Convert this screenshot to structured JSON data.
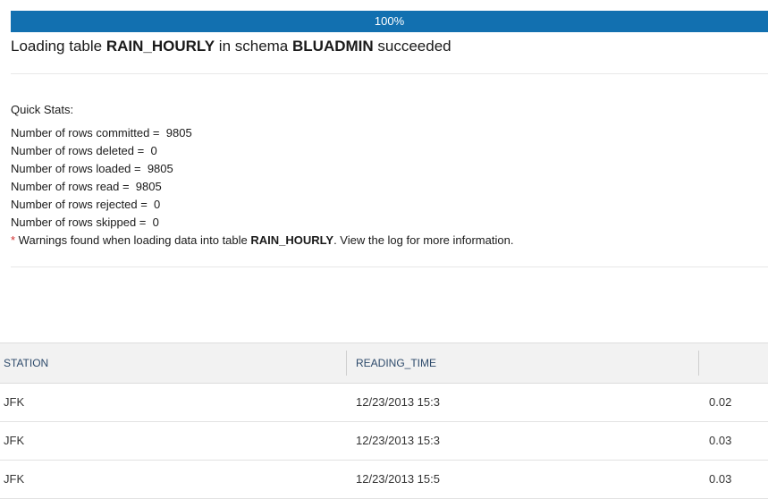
{
  "progress": {
    "value": 100,
    "label": "100%",
    "color": "#1270b0"
  },
  "title": {
    "prefix": "Loading table ",
    "table": "RAIN_HOURLY",
    "middle": " in schema ",
    "schema": "BLUADMIN",
    "suffix": " succeeded"
  },
  "quick_stats": {
    "heading": "Quick Stats:",
    "rows": [
      "Number of rows committed =  9805",
      "Number of rows deleted =  0",
      "Number of rows loaded =  9805",
      "Number of rows read =  9805",
      "Number of rows rejected =  0",
      "Number of rows skipped =  0"
    ],
    "warning": {
      "star": "*",
      "prefix": " Warnings found when loading data into table ",
      "table": "RAIN_HOURLY",
      "suffix": ". View the log for more information."
    }
  },
  "grid": {
    "columns": [
      "STATION",
      "READING_TIME",
      ""
    ],
    "rows": [
      [
        "JFK",
        "12/23/2013 15:3",
        "0.02"
      ],
      [
        "JFK",
        "12/23/2013 15:3",
        "0.03"
      ],
      [
        "JFK",
        "12/23/2013 15:5",
        "0.03"
      ]
    ]
  }
}
